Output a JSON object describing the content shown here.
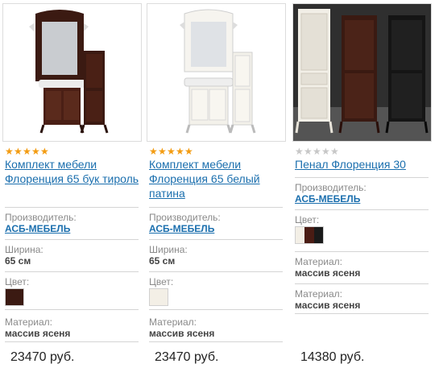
{
  "products": [
    {
      "rating": 5,
      "title": "Комплект мебели Флоренция 65 бук тироль",
      "manufacturer_label": "Производитель:",
      "manufacturer": "АСБ-МЕБЕЛЬ",
      "width_label": "Ширина:",
      "width": "65 см",
      "color_label": "Цвет:",
      "color_swatch": "#3b1a12",
      "material_label": "Материал:",
      "material": "массив ясеня",
      "price": "23470 руб."
    },
    {
      "rating": 5,
      "title": "Комплект мебели Флоренция 65 белый патина",
      "manufacturer_label": "Производитель:",
      "manufacturer": "АСБ-МЕБЕЛЬ",
      "width_label": "Ширина:",
      "width": "65 см",
      "color_label": "Цвет:",
      "color_swatch": "#f3efe6",
      "material_label": "Материал:",
      "material": "массив ясеня",
      "price": "23470 руб."
    },
    {
      "rating": 0,
      "title": "Пенал Флоренция 30",
      "manufacturer_label": "Производитель:",
      "manufacturer": "АСБ-МЕБЕЛЬ",
      "color_label": "Цвет:",
      "color_swatches": [
        "#f3efe6",
        "#4a1c14",
        "#1a1a1a"
      ],
      "material_label": "Материал:",
      "material": "массив ясеня",
      "material2_label": "Материал:",
      "material2": "массив ясеня",
      "price": "14380 руб."
    }
  ],
  "colors": {
    "link": "#1b6fae",
    "star_on": "#f39c12",
    "star_off": "#c7c7c7"
  }
}
